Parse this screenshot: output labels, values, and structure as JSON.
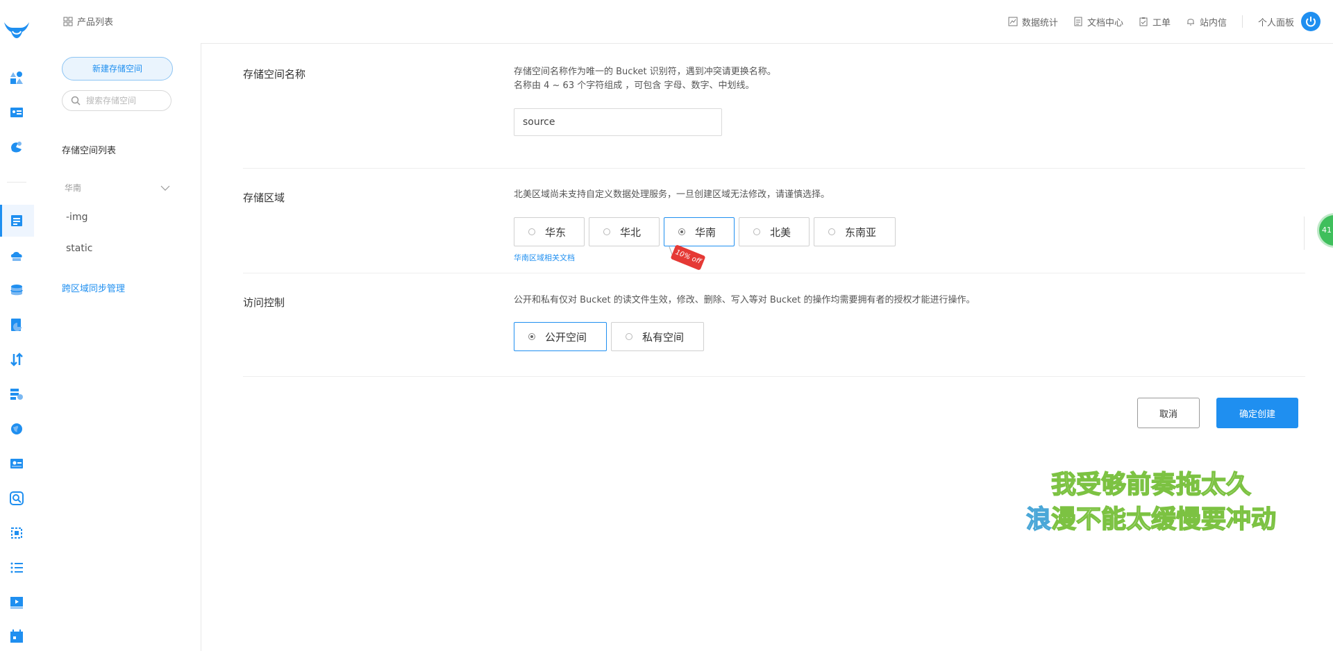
{
  "topbar": {
    "product_list": "产品列表",
    "nav": [
      {
        "label": "数据统计",
        "icon": "chart-icon"
      },
      {
        "label": "文档中心",
        "icon": "document-icon"
      },
      {
        "label": "工单",
        "icon": "clipboard-icon"
      },
      {
        "label": "站内信",
        "icon": "bell-icon"
      }
    ],
    "personal_panel": "个人面板"
  },
  "sidebar": {
    "new_bucket": "新建存储空间",
    "search_placeholder": "搜索存储空间",
    "bucket_list_title": "存储空间列表",
    "region_group": "华南",
    "buckets": [
      "-img",
      "static"
    ],
    "cross_region": "跨区域同步管理"
  },
  "form": {
    "name": {
      "label": "存储空间名称",
      "desc_line1": "存储空间名称作为唯一的 Bucket 识别符，遇到冲突请更换名称。",
      "desc_line2": "名称由 4 ~ 63 个字符组成 ，可包含 字母、数字、中划线。",
      "value": "source"
    },
    "region": {
      "label": "存储区域",
      "desc": "北美区域尚未支持自定义数据处理服务，一旦创建区域无法修改，请谨慎选择。",
      "options": [
        "华东",
        "华北",
        "华南",
        "北美",
        "东南亚"
      ],
      "selected": "华南",
      "doc_link": "华南区域相关文档",
      "promo": "10% off"
    },
    "access": {
      "label": "访问控制",
      "desc": "公开和私有仅对 Bucket 的读文件生效，修改、删除、写入等对 Bucket 的操作均需要拥有者的授权才能进行操作。",
      "options": [
        "公开空间",
        "私有空间"
      ],
      "selected": "公开空间"
    },
    "cancel": "取消",
    "confirm": "确定创建"
  },
  "float_badge": "41",
  "overlay": {
    "line1": "我受够前奏拖太久",
    "line2_accent": "浪",
    "line2_rest": "漫不能太缓慢要冲动"
  },
  "colors": {
    "accent": "#1f8ff0",
    "lyrics_stroke": "#7cc242",
    "promo": "#e53935"
  }
}
